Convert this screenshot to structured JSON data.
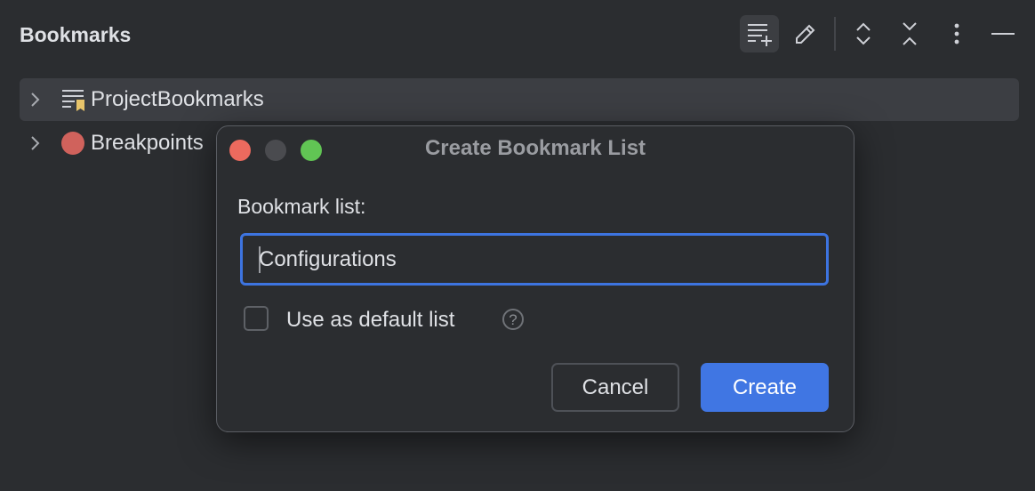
{
  "panel": {
    "title": "Bookmarks",
    "toolbar": [
      {
        "name": "add-list-icon",
        "active": true
      },
      {
        "name": "edit-icon"
      },
      {
        "name": "expand-all-icon"
      },
      {
        "name": "collapse-all-icon"
      },
      {
        "name": "more-options-icon"
      },
      {
        "name": "minimize-icon"
      }
    ],
    "items": [
      {
        "label": "ProjectBookmarks",
        "icon": "bookmark-list-icon",
        "selected": true
      },
      {
        "label": "Breakpoints",
        "icon": "breakpoint-icon"
      }
    ]
  },
  "dialog": {
    "title": "Create Bookmark List",
    "field_label": "Bookmark list:",
    "field_value": "Configurations",
    "checkbox_label": "Use as default list",
    "checkbox_checked": false,
    "help_glyph": "?",
    "cancel_label": "Cancel",
    "create_label": "Create"
  },
  "colors": {
    "accent": "#4076e3",
    "close": "#ec6a5e",
    "zoom": "#61c554",
    "breakpoint": "#d0625c",
    "bookmark": "#e8c46a"
  }
}
